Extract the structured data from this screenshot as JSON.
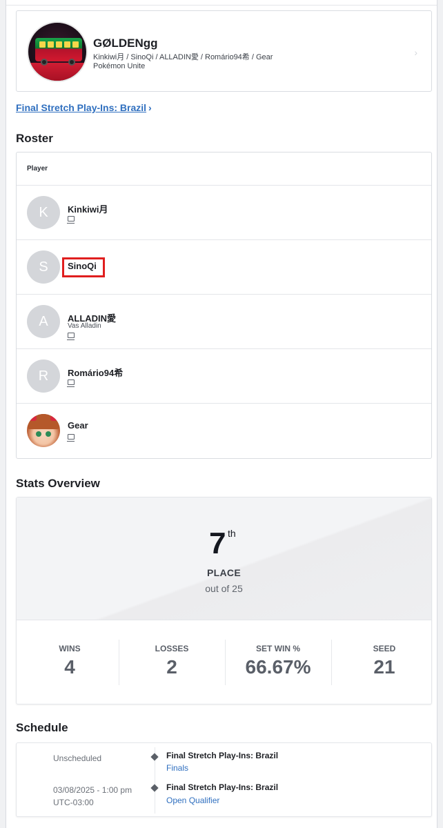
{
  "team": {
    "name": "GØLDENgg",
    "roster_line": "Kinkiwi月 / SinoQi / ALLADIN愛 / Romário94希 / Gear",
    "game": "Pokémon Unite"
  },
  "event_link": {
    "label": "Final Stretch Play-Ins: Brazil"
  },
  "roster": {
    "title": "Roster",
    "column_header": "Player",
    "players": [
      {
        "initial": "K",
        "name": "Kinkiwi月",
        "sub": ""
      },
      {
        "initial": "S",
        "name": "SinoQi",
        "sub": ""
      },
      {
        "initial": "A",
        "name": "ALLADIN愛",
        "sub": "Vas Alladin"
      },
      {
        "initial": "R",
        "name": "Romário94希",
        "sub": ""
      },
      {
        "initial": "",
        "name": "Gear",
        "sub": ""
      }
    ]
  },
  "stats": {
    "title": "Stats Overview",
    "place": "7",
    "place_suffix": "th",
    "place_label": "PLACE",
    "out_of": "out of 25",
    "items": [
      {
        "label": "WINS",
        "value": "4"
      },
      {
        "label": "LOSSES",
        "value": "2"
      },
      {
        "label": "SET WIN %",
        "value": "66.67%"
      },
      {
        "label": "SEED",
        "value": "21"
      }
    ]
  },
  "schedule": {
    "title": "Schedule",
    "entries": [
      {
        "time_line1": "Unscheduled",
        "time_line2": "",
        "event": "Final Stretch Play-Ins: Brazil",
        "round": "Finals"
      },
      {
        "time_line1": "03/08/2025 - 1:00 pm",
        "time_line2": "UTC-03:00",
        "event": "Final Stretch Play-Ins: Brazil",
        "round": "Open Qualifier"
      }
    ]
  },
  "colors": {
    "link": "#2f6fbf",
    "highlight": "#e01e1e",
    "avatar_bg": "#d4d6da"
  }
}
